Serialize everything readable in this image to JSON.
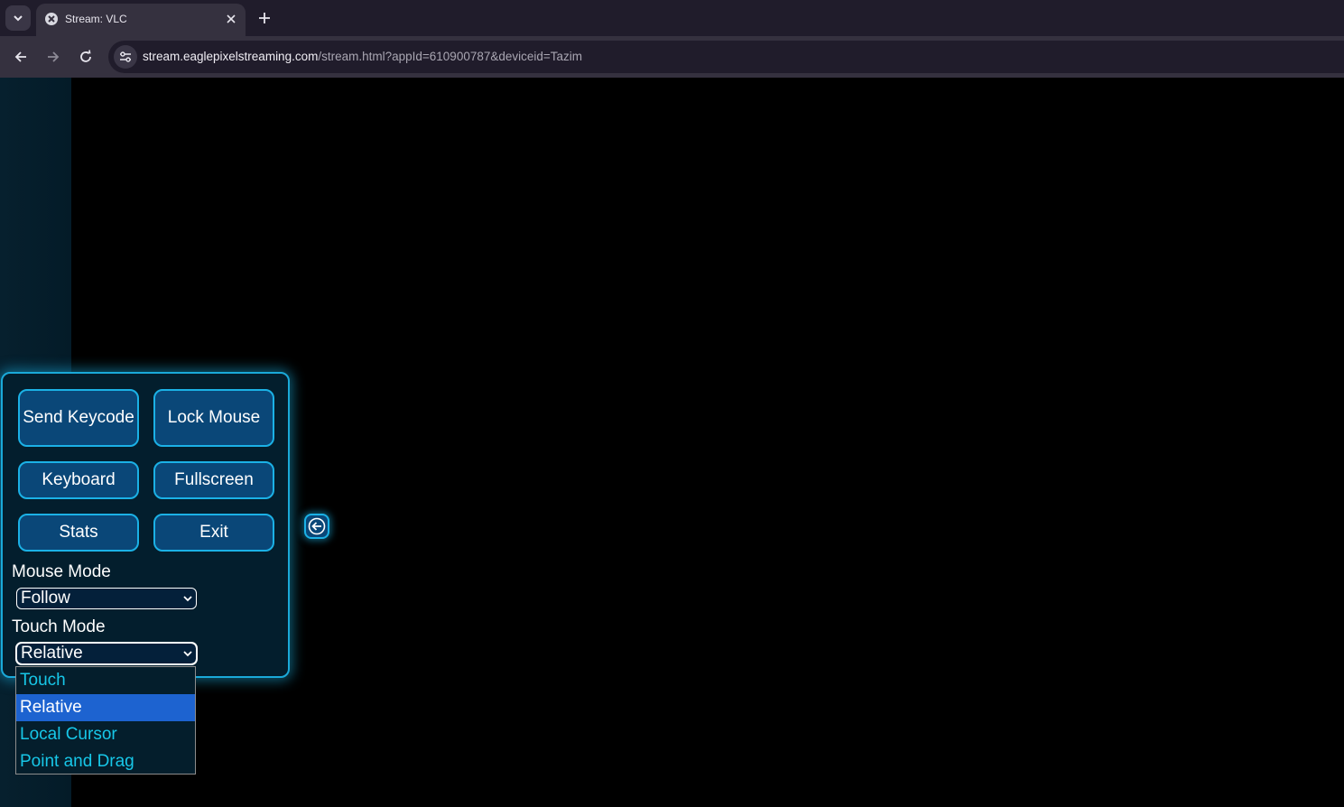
{
  "browser": {
    "tab": {
      "title": "Stream: VLC"
    },
    "url": {
      "host": "stream.eaglepixelstreaming.com",
      "path": "/stream.html?appId=610900787&deviceid=Tazim"
    }
  },
  "panel": {
    "buttons": {
      "send_keycode": "Send Keycode",
      "lock_mouse": "Lock Mouse",
      "keyboard": "Keyboard",
      "fullscreen": "Fullscreen",
      "stats": "Stats",
      "exit": "Exit"
    },
    "mouse_mode": {
      "label": "Mouse Mode",
      "value": "Follow"
    },
    "touch_mode": {
      "label": "Touch Mode",
      "value": "Relative",
      "options": [
        "Touch",
        "Relative",
        "Local Cursor",
        "Point and Drag"
      ],
      "selected_index": 1
    }
  },
  "icons": {
    "tab_list": "chevron-down-icon",
    "favicon": "vlc-favicon-icon",
    "tab_close": "close-icon",
    "new_tab": "plus-icon",
    "back": "arrow-left-icon",
    "forward": "arrow-right-icon",
    "reload": "reload-icon",
    "site_info": "tune-icon",
    "collapse_panel": "arrow-left-circle-icon"
  },
  "colors": {
    "accent": "#1bb1e6",
    "button_fill": "#0a4778",
    "dropdown_text": "#17c7e8",
    "dropdown_selected": "#1d63d0"
  }
}
